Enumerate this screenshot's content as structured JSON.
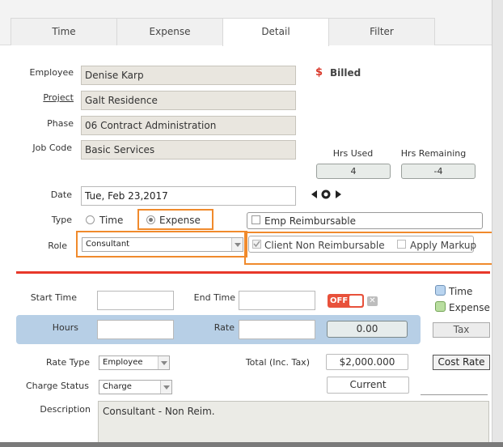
{
  "tabs": [
    {
      "label": "Time"
    },
    {
      "label": "Expense"
    },
    {
      "label": "Detail"
    },
    {
      "label": "Filter"
    }
  ],
  "header": {
    "employee_label": "Employee",
    "employee_value": "Denise Karp",
    "project_label": "Project",
    "project_value": "Galt Residence",
    "phase_label": "Phase",
    "phase_value": "06 Contract Administration",
    "jobcode_label": "Job Code",
    "jobcode_value": "Basic Services",
    "billed_icon": "$",
    "billed_label": "Billed",
    "hrs_used_label": "Hrs Used",
    "hrs_used_value": "4",
    "hrs_remaining_label": "Hrs Remaining",
    "hrs_remaining_value": "-4"
  },
  "date": {
    "label": "Date",
    "value": "Tue, Feb 23,2017"
  },
  "type": {
    "label": "Type",
    "time_label": "Time",
    "expense_label": "Expense",
    "selected": "Expense"
  },
  "role": {
    "label": "Role",
    "value": "Consultant"
  },
  "options": {
    "emp_reimbursable": "Emp Reimbursable",
    "client_non_reimbursable": "Client Non Reimbursable",
    "apply_markup": "Apply Markup"
  },
  "entry": {
    "start_time_label": "Start Time",
    "end_time_label": "End Time",
    "toggle_label": "OFF",
    "legend_time": "Time",
    "legend_expense": "Expense",
    "hours_label": "Hours",
    "rate_label": "Rate",
    "amount_value": "0.00",
    "tax_label": "Tax",
    "rate_type_label": "Rate Type",
    "rate_type_value": "Employee",
    "total_label": "Total (Inc. Tax)",
    "total_value": "$2,000.000",
    "cost_rate_label": "Cost Rate",
    "charge_status_label": "Charge Status",
    "charge_status_value": "Charge",
    "current_label": "Current",
    "description_label": "Description",
    "description_value": "Consultant - Non Reim."
  },
  "colors": {
    "accent_orange": "#f08a2c",
    "divider_red": "#e8382a",
    "billed_red": "#d9372a",
    "toggle_red": "#e8513b",
    "hours_band": "#b7cfe6"
  }
}
